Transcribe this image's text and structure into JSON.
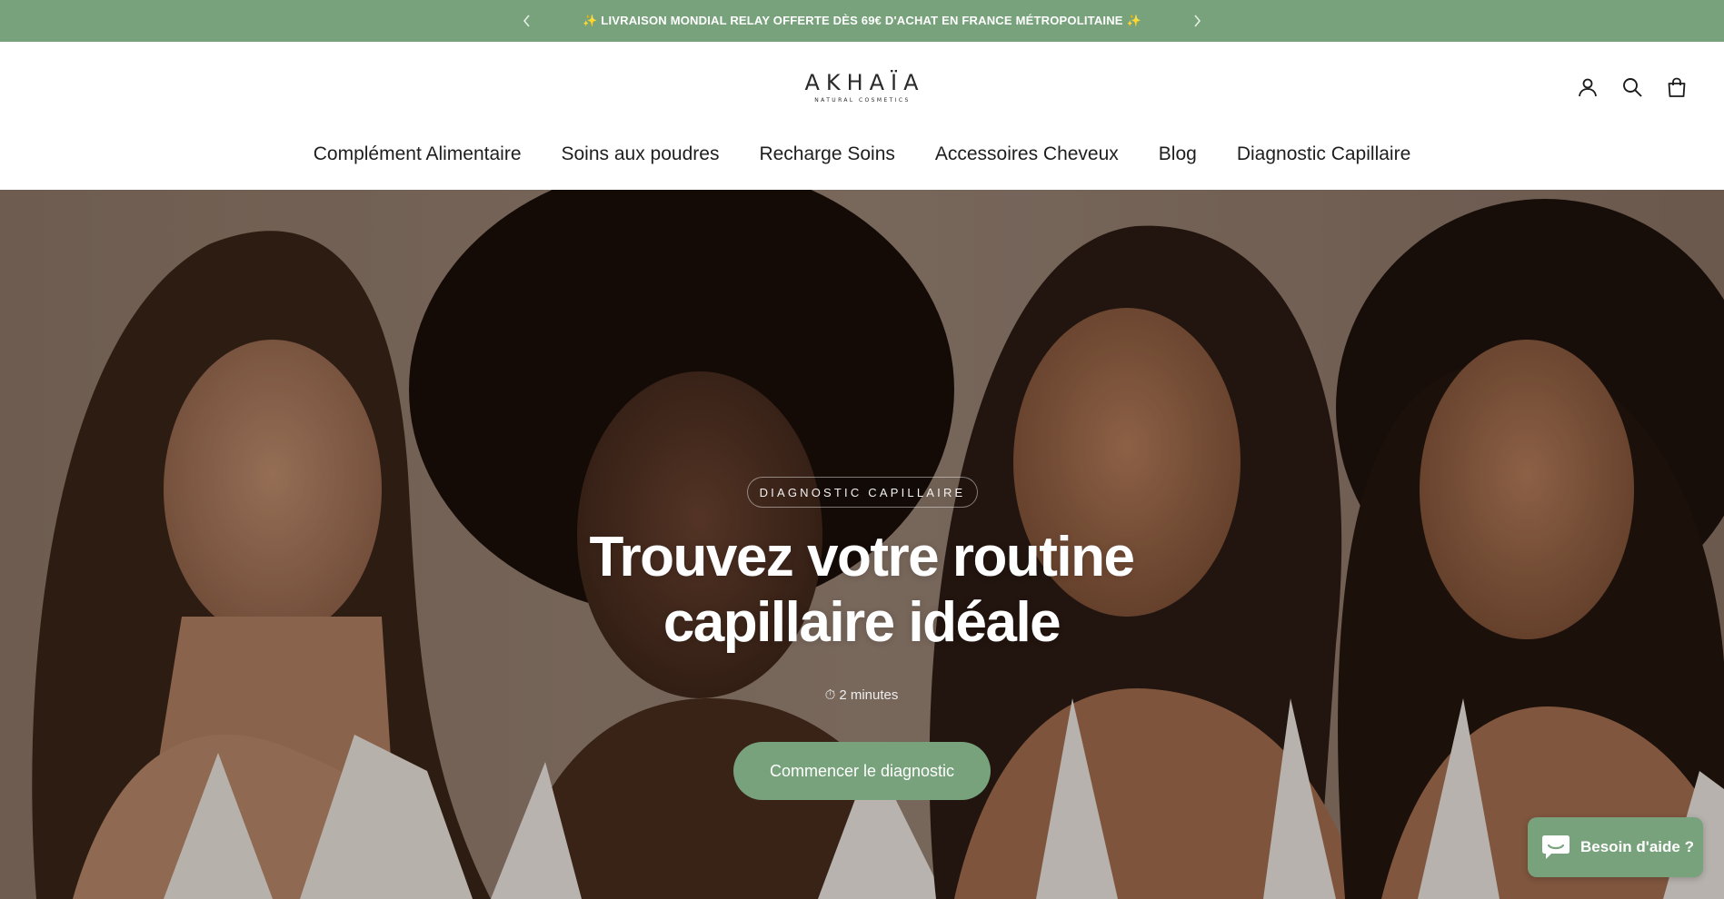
{
  "announcement": {
    "text": "✨ LIVRAISON MONDIAL RELAY OFFERTE DÈS 69€ D'ACHAT EN FRANCE MÉTROPOLITAINE ✨",
    "prev_icon": "chevron-left-icon",
    "next_icon": "chevron-right-icon",
    "background": "#77a27b"
  },
  "header": {
    "logo": {
      "word": "AKHAÏA",
      "tagline": "NATURAL COSMETICS"
    },
    "icons": [
      "account-icon",
      "search-icon",
      "bag-icon"
    ]
  },
  "nav": {
    "items": [
      {
        "label": "Complément Alimentaire"
      },
      {
        "label": "Soins aux poudres"
      },
      {
        "label": "Recharge Soins"
      },
      {
        "label": "Accessoires Cheveux"
      },
      {
        "label": "Blog"
      },
      {
        "label": "Diagnostic Capillaire"
      }
    ]
  },
  "hero": {
    "eyebrow": "DIAGNOSTIC CAPILLAIRE",
    "title_line1": "Trouvez votre routine",
    "title_line2": "capillaire idéale",
    "duration_icon": "⏱",
    "duration": "2 minutes",
    "cta_label": "Commencer le diagnostic",
    "cta_color": "#77a27b"
  },
  "chat": {
    "label": "Besoin d'aide ?",
    "icon": "chat-bubble-icon"
  }
}
